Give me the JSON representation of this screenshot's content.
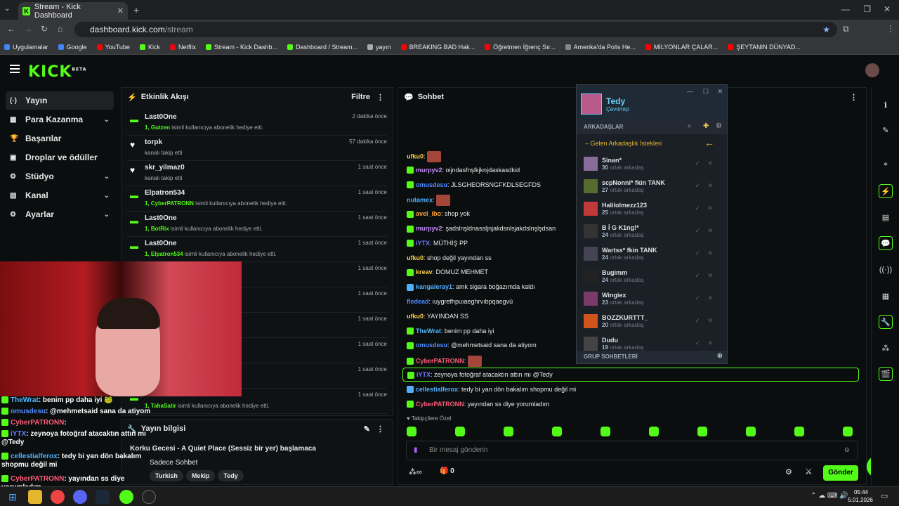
{
  "browser": {
    "tab_title": "Stream - Kick Dashboard",
    "url_host": "dashboard.kick.com",
    "url_path": "/stream",
    "bookmarks": [
      "Uygulamalar",
      "Google",
      "YouTube",
      "Kick",
      "Netflix",
      "Stream - Kick Dashb...",
      "Dashboard / Stream...",
      "yayın",
      "BREAKING BAD Hak...",
      "Öğretmen İğrenç Sır...",
      "Amerika'da Polis He...",
      "MİLYONLAR ÇALAR...",
      "ŞEYTANIN DÜNYAD..."
    ]
  },
  "kick": {
    "logo": "KICK",
    "beta": "BETA"
  },
  "nav": [
    {
      "label": "Yayın",
      "icon": "(·)"
    },
    {
      "label": "Para Kazanma",
      "icon": "▦"
    },
    {
      "label": "Başarılar",
      "icon": "🏆"
    },
    {
      "label": "Droplar ve ödüller",
      "icon": "▣"
    },
    {
      "label": "Stüdyo",
      "icon": "⚙"
    },
    {
      "label": "Kanal",
      "icon": "▤"
    },
    {
      "label": "Ayarlar",
      "icon": "⚙"
    }
  ],
  "activity": {
    "title": "Etkinlik Akışı",
    "filter": "Filtre",
    "rows": [
      {
        "name": "Last0One",
        "time": "2 dakika önce",
        "gifter": "1, Gutzen",
        "desc": " isimli kullanıcıya abonelik hediye etti."
      },
      {
        "name": "torpk",
        "time": "57 dakika önce",
        "gifter": "",
        "desc": "kanalı takip etti"
      },
      {
        "name": "skr_yilmaz0",
        "time": "1 saat önce",
        "gifter": "",
        "desc": "kanalı takip etti"
      },
      {
        "name": "Elpatron534",
        "time": "1 saat önce",
        "gifter": "1, CyberPATRONN",
        "desc": " isimli kullanıcıya abonelik hediye etti."
      },
      {
        "name": "Last0One",
        "time": "1 saat önce",
        "gifter": "1, BotRix",
        "desc": " isimli kullanıcıya abonelik hediye etti."
      },
      {
        "name": "Last0One",
        "time": "1 saat önce",
        "gifter": "1, Elpatron534",
        "desc": " isimli kullanıcıya abonelik hediye etti."
      },
      {
        "name": "",
        "time": "1 saat önce",
        "gifter": "",
        "desc": ""
      },
      {
        "name": "",
        "time": "1 saat önce",
        "gifter": "",
        "desc": ""
      },
      {
        "name": "",
        "time": "1 saat önce",
        "gifter": "",
        "desc": "k hediye etti."
      },
      {
        "name": "",
        "time": "1 saat önce",
        "gifter": "",
        "desc": ""
      },
      {
        "name": "",
        "time": "1 saat önce",
        "gifter": "",
        "desc": ""
      },
      {
        "name": "",
        "time": "1 saat önce",
        "gifter": "1, TahaSatir",
        "desc": " isimli kullanıcıya abonelik hediye etti."
      }
    ]
  },
  "stream_info": {
    "title": "Yayın bilgisi",
    "stream_title": "Korku Gecesi - A Quiet Place (Sessiz bir yer) başlamaca",
    "category": "Sadece Sohbet",
    "tags": [
      "Turkish",
      "Mekip",
      "Tedy"
    ]
  },
  "overlay_chat": [
    {
      "user": "TheWrat",
      "color": "#52b8ff",
      "text": ": benim pp daha iyi 🐸"
    },
    {
      "user": "omusdesu",
      "color": "#4f8cff",
      "text": ": @mehmetsaid sana da atiyom"
    },
    {
      "user": "CyberPATRONN",
      "color": "#ff5c7a",
      "text": ": "
    },
    {
      "user": "iYTX",
      "color": "#6b7cff",
      "text": ": zeynoya fotoğraf atacaktın attın mı @Tedy"
    },
    {
      "user": "cellestialferox",
      "color": "#4fb0ff",
      "text": ": tedy bi yan dön bakalım shopmu değil mi"
    },
    {
      "user": "CyberPATRONN",
      "color": "#ff5c7a",
      "text": ": yayından ss diye yorumladım"
    }
  ],
  "chat": {
    "title": "Sohbet",
    "messages": [
      {
        "user": "ufku0",
        "color": "#ffd24a",
        "text": ": "
      },
      {
        "user": "murpyv2",
        "color": "#c78cff",
        "text": ": oijndasfnşlkjknjdaskasdkid"
      },
      {
        "user": "omusdesu",
        "color": "#4f8cff",
        "text": ": JLSGHEORSNGFKDLSEGFDS"
      },
      {
        "user": "nutamex",
        "color": "#4fb0ff",
        "text": ": "
      },
      {
        "user": "avel_ibo",
        "color": "#ffa53a",
        "text": ": shop yok"
      },
      {
        "user": "murpyv2",
        "color": "#c78cff",
        "text": ": şadslnşldnassljnjakdsnlsjakdslnşlşdsan"
      },
      {
        "user": "iYTX",
        "color": "#6b7cff",
        "text": ": MÜTHİŞ PP"
      },
      {
        "user": "ufku0",
        "color": "#ffd24a",
        "text": ": shop değil yayından ss"
      },
      {
        "user": "kreav",
        "color": "#ffd24a",
        "text": ": DOMUZ MEHMET"
      },
      {
        "user": "kangaleray1",
        "color": "#4fb0ff",
        "text": ": amk sigara boğazımda kaldı"
      },
      {
        "user": "fledead",
        "color": "#4f8cff",
        "text": ": ıuygrefhpuıaeghrvıbpqaegvü"
      },
      {
        "user": "ufku0",
        "color": "#ffd24a",
        "text": ": YAYINDAN SS"
      },
      {
        "user": "TheWrat",
        "color": "#52b8ff",
        "text": ": benim pp daha iyi"
      },
      {
        "user": "omusdesu",
        "color": "#4f8cff",
        "text": ": @mehmetsaid sana da atiyom"
      },
      {
        "user": "CyberPATRONN",
        "color": "#ff5c7a",
        "text": ": "
      },
      {
        "user": "iYTX",
        "color": "#6b7cff",
        "text": ": zeynoya fotoğraf atacaktın attın mı @Tedy"
      },
      {
        "user": "cellestialferox",
        "color": "#4fb0ff",
        "text": ": tedy bi yan dön bakalım shopmu değil mi"
      },
      {
        "user": "CyberPATRONN",
        "color": "#ff5c7a",
        "text": ": yayından ss diye yorumladım"
      }
    ],
    "followers_label": "Takipçilere Özel",
    "input_placeholder": "Bir mesaj gönderin",
    "count_label": "0",
    "send_label": "Gönder"
  },
  "friends": {
    "user": "Tedy",
    "status": "Çevrimiçi",
    "section": "ARKADAŞLAR",
    "incoming": "– Gelen Arkadaşlık İstekleri",
    "group_chats": "GRUP SOHBETLERİ",
    "mutual_suffix": " ortak arkadaş",
    "list": [
      {
        "name": "Sinan*",
        "mutual": "30"
      },
      {
        "name": "scpNonni* fkin TANK",
        "mutual": "27"
      },
      {
        "name": "Halilolmezz123",
        "mutual": "25"
      },
      {
        "name": "B İ G K1ng!*",
        "mutual": "24"
      },
      {
        "name": "Wartss* fkin TANK",
        "mutual": "24"
      },
      {
        "name": "Bugimm",
        "mutual": "24"
      },
      {
        "name": "Wingiex",
        "mutual": "23"
      },
      {
        "name": "BOZZKURTTT_",
        "mutual": "20"
      },
      {
        "name": "Dudu",
        "mutual": "19"
      }
    ]
  },
  "taskbar": {
    "time": "05:44",
    "date": "5.01.2026"
  },
  "colors": {
    "accent": "#53fc18",
    "bg": "#0b0e0f"
  }
}
